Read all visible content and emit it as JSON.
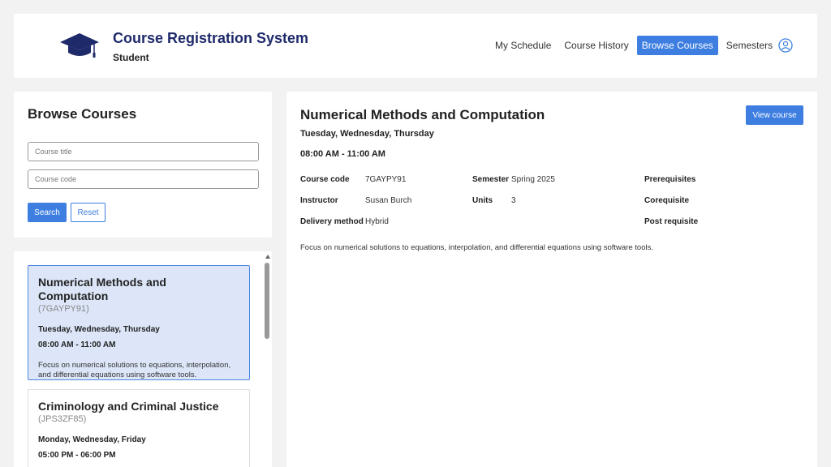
{
  "header": {
    "app_title": "Course Registration System",
    "role": "Student",
    "nav": [
      {
        "label": "My Schedule",
        "active": false
      },
      {
        "label": "Course History",
        "active": false
      },
      {
        "label": "Browse Courses",
        "active": true
      },
      {
        "label": "Semesters",
        "active": false
      }
    ]
  },
  "search": {
    "title": "Browse Courses",
    "title_placeholder": "Course title",
    "code_placeholder": "Course code",
    "search_label": "Search",
    "reset_label": "Reset"
  },
  "courses": [
    {
      "title": "Numerical Methods and Computation",
      "code": "(7GAYPY91)",
      "days": "Tuesday, Wednesday, Thursday",
      "time": "08:00 AM - 11:00 AM",
      "description": "Focus on numerical solutions to equations, interpolation, and differential equations using software tools.",
      "selected": true
    },
    {
      "title": "Criminology and Criminal Justice",
      "code": "(JPS3ZF85)",
      "days": "Monday, Wednesday, Friday",
      "time": "05:00 PM - 06:00 PM",
      "description": "",
      "selected": false
    }
  ],
  "detail": {
    "title": "Numerical Methods and Computation",
    "days": "Tuesday, Wednesday, Thursday",
    "time": "08:00 AM - 11:00 AM",
    "view_label": "View course",
    "labels": {
      "course_code": "Course code",
      "instructor": "Instructor",
      "delivery": "Delivery method",
      "semester": "Semester",
      "units": "Units",
      "prerequisites": "Prerequisites",
      "corequisite": "Corequisite",
      "post_requisite": "Post requisite"
    },
    "values": {
      "course_code": "7GAYPY91",
      "instructor": "Susan Burch",
      "delivery": "Hybrid",
      "semester": "Spring 2025",
      "units": "3"
    },
    "description": "Focus on numerical solutions to equations, interpolation, and differential equations using software tools."
  },
  "colors": {
    "accent": "#3d7ee0",
    "title_navy": "#1f2a6b",
    "selected_card": "#dce6f8"
  },
  "icons": {
    "logo": "graduation-cap-icon",
    "profile": "user-circle-icon"
  }
}
